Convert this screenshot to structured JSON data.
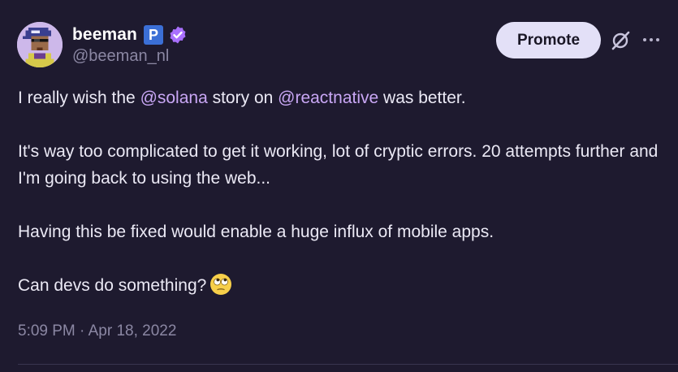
{
  "author": {
    "display_name": "beeman",
    "badge_letter": "P",
    "handle": "@beeman_nl"
  },
  "actions": {
    "promote_label": "Promote",
    "grok_icon": "slashed-circle-icon",
    "more_icon": "ellipsis-icon"
  },
  "tweet": {
    "line1_pre": "I really wish the ",
    "mention1": "@solana",
    "line1_mid": " story on ",
    "mention2": "@reactnative",
    "line1_post": " was better.",
    "para2": "It's way too complicated to get it working, lot of cryptic errors. 20 attempts further and I'm going back to using the web...",
    "para3": "Having this be fixed would enable a huge influx of mobile apps.",
    "para4": "Can devs do something?",
    "emoji": "face-with-rolling-eyes"
  },
  "meta": {
    "timestamp": "5:09 PM · Apr 18, 2022"
  },
  "colors": {
    "background": "#1e1a2f",
    "mention": "#c9a7f5",
    "verified": "#a970ff",
    "badge": "#3b6fd6",
    "promote_bg": "#e3e0f7"
  }
}
